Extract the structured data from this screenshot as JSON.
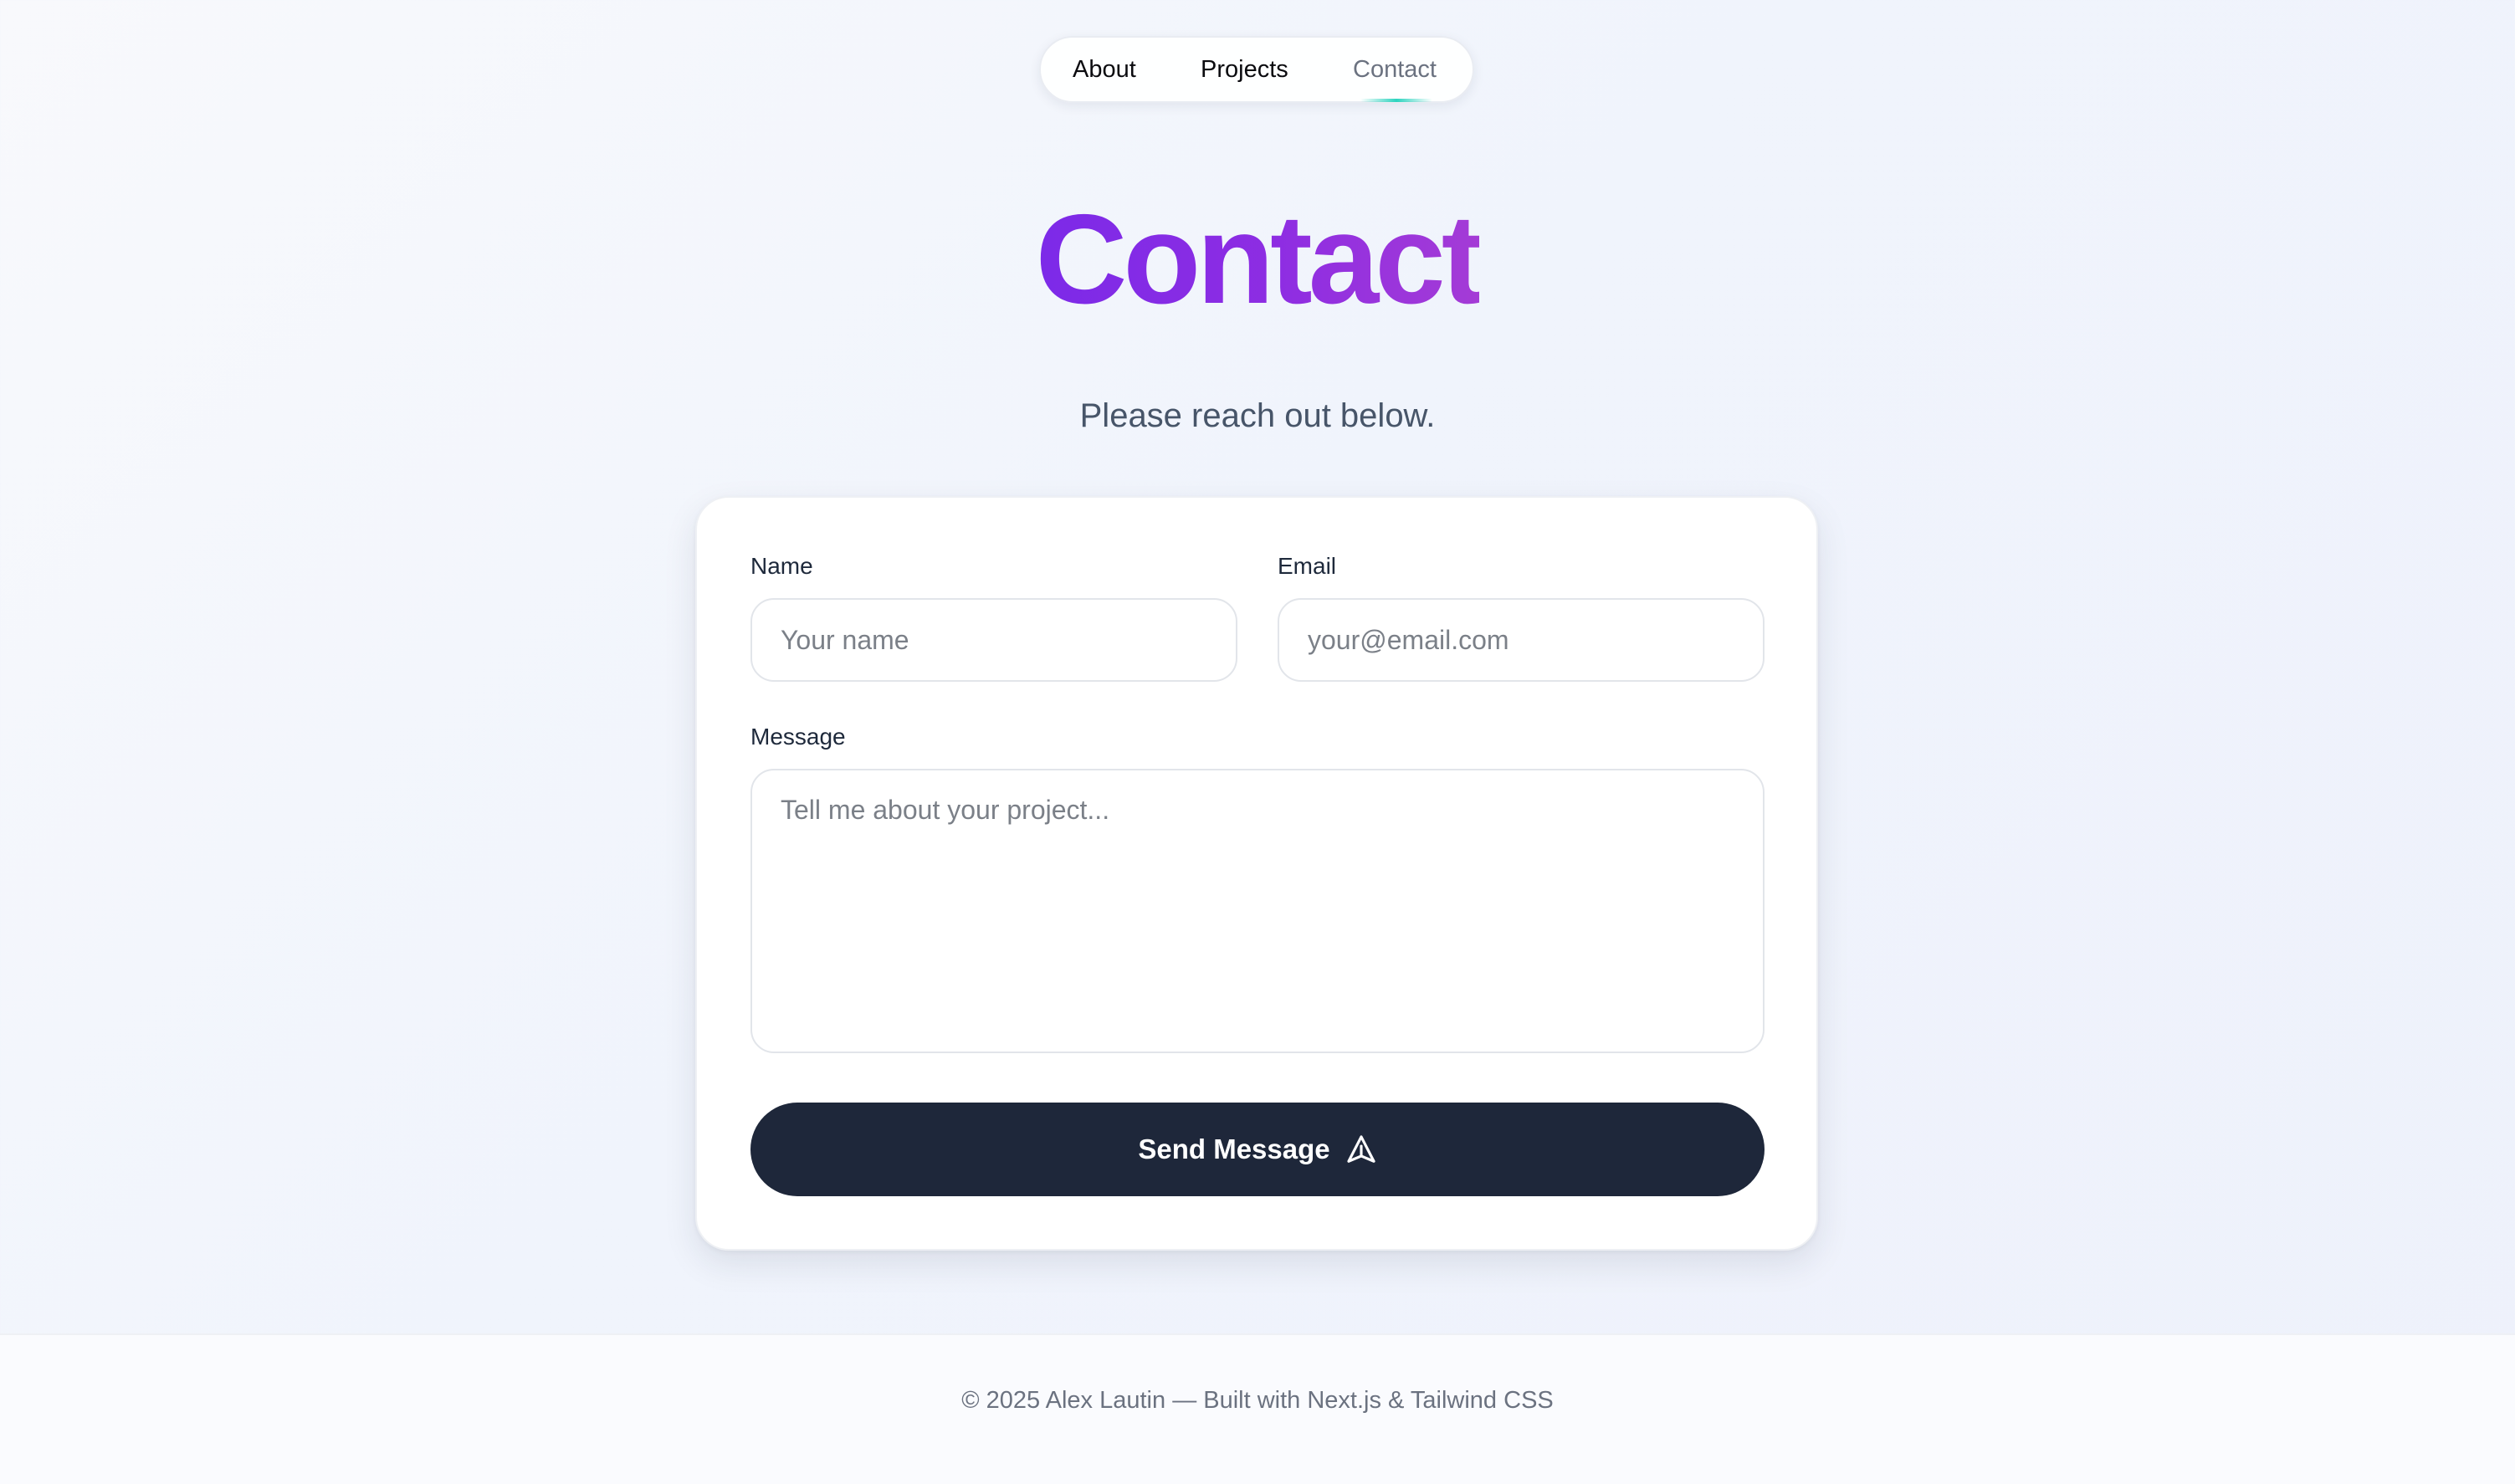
{
  "nav": {
    "items": [
      {
        "label": "About"
      },
      {
        "label": "Projects"
      },
      {
        "label": "Contact",
        "active": true
      }
    ],
    "active_indicator_color": "#2dd4bf"
  },
  "hero": {
    "title": "Contact",
    "subtitle": "Please reach out below.",
    "title_gradient": [
      "#7c2ae8",
      "#a43bd6"
    ]
  },
  "form": {
    "name": {
      "label": "Name",
      "placeholder": "Your name",
      "value": ""
    },
    "email": {
      "label": "Email",
      "placeholder": "your@email.com",
      "value": ""
    },
    "message": {
      "label": "Message",
      "placeholder": "Tell me about your project...",
      "value": ""
    },
    "submit": {
      "label": "Send Message",
      "icon": "send-icon",
      "background": "#1e273a"
    }
  },
  "footer": {
    "text": "© 2025 Alex Lautin — Built with Next.js & Tailwind CSS"
  }
}
